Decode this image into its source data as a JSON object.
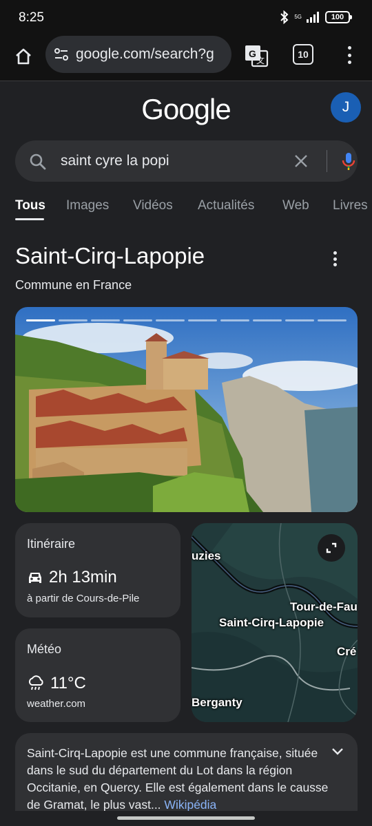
{
  "status_bar": {
    "time": "8:25",
    "network": "5G",
    "battery": "100"
  },
  "browser": {
    "url": "google.com/search?g",
    "tab_count": "10",
    "icons": [
      "home-icon",
      "site-settings-icon",
      "translate-icon",
      "overflow-menu-icon"
    ]
  },
  "search": {
    "logo": "Google",
    "avatar_initial": "J",
    "query": "saint cyre la popi",
    "tabs": [
      "Tous",
      "Images",
      "Vidéos",
      "Actualités",
      "Web",
      "Livres"
    ],
    "active_tab": "Tous"
  },
  "knowledge_panel": {
    "title": "Saint-Cirq-Lapopie",
    "subtitle": "Commune en France",
    "image_count": 10,
    "active_image": 1
  },
  "itinerary": {
    "label": "Itinéraire",
    "duration": "2h 13min",
    "origin": "à partir de Cours-de-Pile"
  },
  "weather": {
    "label": "Météo",
    "temperature": "11°C",
    "source": "weather.com"
  },
  "map": {
    "labels": {
      "a": "uzies",
      "b": "Tour-de-Fau",
      "c": "Saint-Cirq-Lapopie",
      "d": "Cré",
      "e": "Berganty"
    }
  },
  "description": {
    "text": "Saint-Cirq-Lapopie est une commune française, située dans le sud du département du Lot dans la région Occitanie, en Quercy. Elle est également dans le causse de Gramat, le plus vast",
    "ellipsis": "...",
    "source": "Wikipédia"
  },
  "colors": {
    "background": "#202124",
    "surface": "#303134",
    "link": "#8ab4f8",
    "avatar": "#1a5fb4"
  }
}
